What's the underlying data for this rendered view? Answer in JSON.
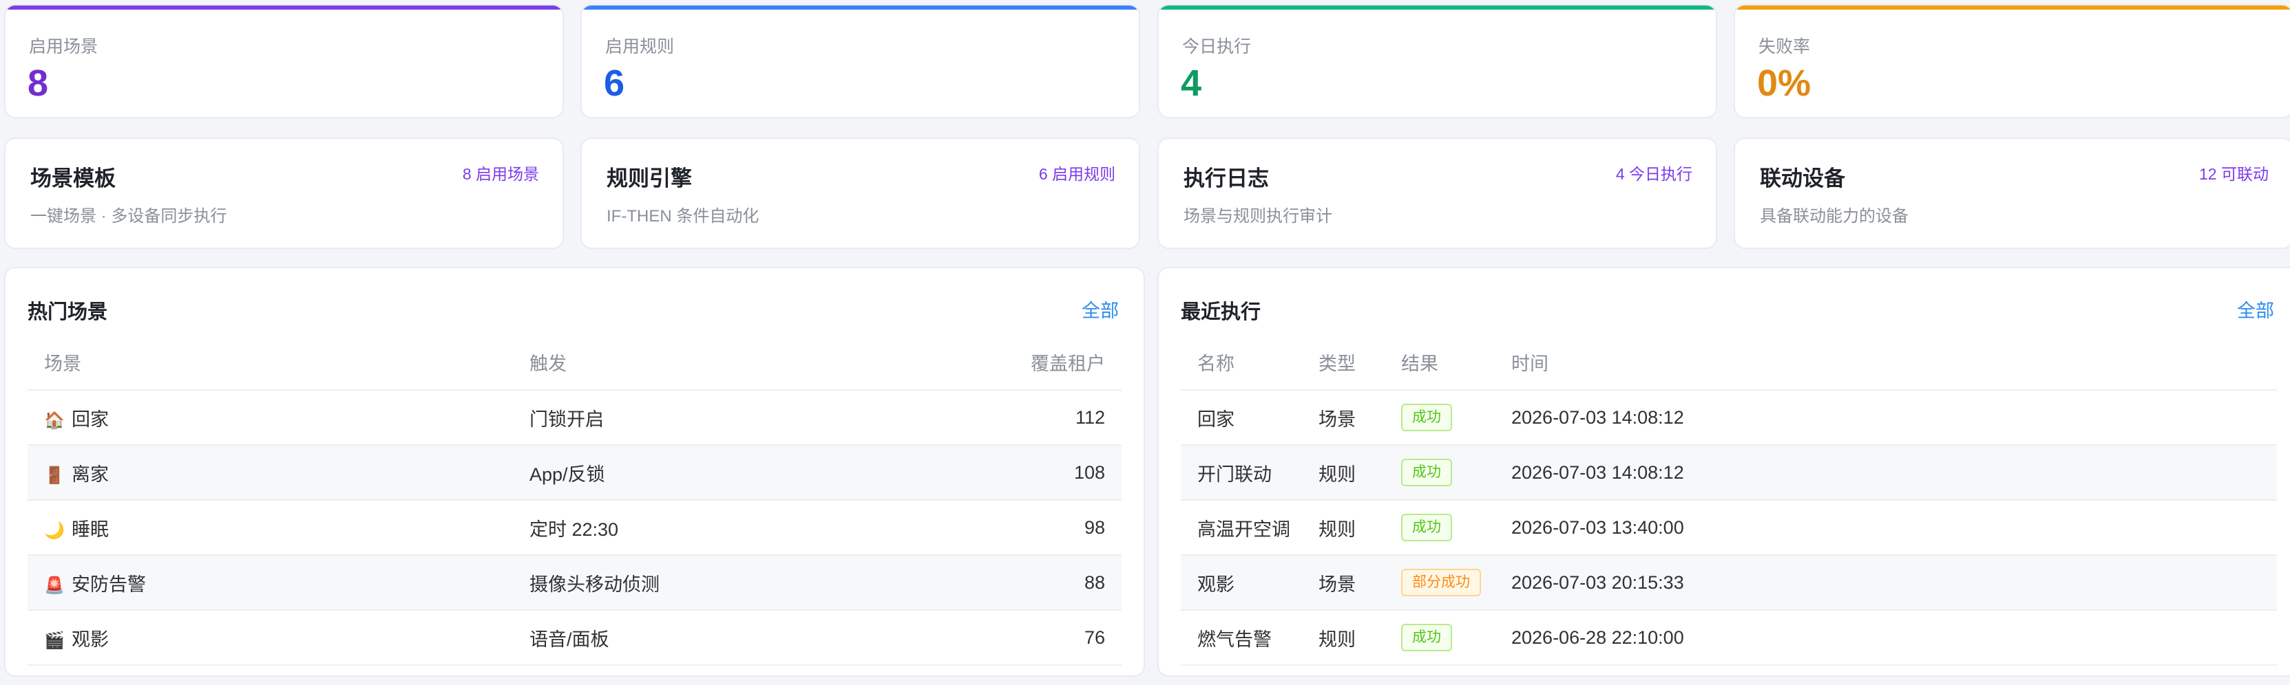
{
  "stats": [
    {
      "label": "启用场景",
      "value": "8",
      "color": "#722ed1"
    },
    {
      "label": "启用规则",
      "value": "6",
      "color": "#1d5ce6"
    },
    {
      "label": "今日执行",
      "value": "4",
      "color": "#0f9b5f"
    },
    {
      "label": "失败率",
      "value": "0%",
      "color": "#e08a12"
    }
  ],
  "stat_bar_colors": [
    "#7b3fe4",
    "#3b82f6",
    "#10b981",
    "#f59e0b"
  ],
  "modules": [
    {
      "title": "场景模板",
      "badge": "8 启用场景",
      "desc": "一键场景 · 多设备同步执行"
    },
    {
      "title": "规则引擎",
      "badge": "6 启用规则",
      "desc": "IF-THEN 条件自动化"
    },
    {
      "title": "执行日志",
      "badge": "4 今日执行",
      "desc": "场景与规则执行审计"
    },
    {
      "title": "联动设备",
      "badge": "12 可联动",
      "desc": "具备联动能力的设备"
    }
  ],
  "hot_scenes": {
    "title": "热门场景",
    "link": "全部",
    "headers": [
      "场景",
      "触发",
      "覆盖租户"
    ],
    "rows": [
      {
        "icon": "🏠",
        "icon_name": "home-icon",
        "name": "回家",
        "trigger": "门锁开启",
        "tenants": "112"
      },
      {
        "icon": "🚪",
        "icon_name": "door-icon",
        "name": "离家",
        "trigger": "App/反锁",
        "tenants": "108"
      },
      {
        "icon": "🌙",
        "icon_name": "moon-icon",
        "name": "睡眠",
        "trigger": "定时 22:30",
        "tenants": "98"
      },
      {
        "icon": "🚨",
        "icon_name": "siren-icon",
        "name": "安防告警",
        "trigger": "摄像头移动侦测",
        "tenants": "88"
      },
      {
        "icon": "🎬",
        "icon_name": "clapper-icon",
        "name": "观影",
        "trigger": "语音/面板",
        "tenants": "76"
      }
    ]
  },
  "recent_runs": {
    "title": "最近执行",
    "link": "全部",
    "headers": [
      "名称",
      "类型",
      "结果",
      "时间"
    ],
    "rows": [
      {
        "name": "回家",
        "type": "场景",
        "result": "成功",
        "status": "success",
        "time": "2026-07-03 14:08:12"
      },
      {
        "name": "开门联动",
        "type": "规则",
        "result": "成功",
        "status": "success",
        "time": "2026-07-03 14:08:12"
      },
      {
        "name": "高温开空调",
        "type": "规则",
        "result": "成功",
        "status": "success",
        "time": "2026-07-03 13:40:00"
      },
      {
        "name": "观影",
        "type": "场景",
        "result": "部分成功",
        "status": "partial",
        "time": "2026-07-03 20:15:33"
      },
      {
        "name": "燃气告警",
        "type": "规则",
        "result": "成功",
        "status": "success",
        "time": "2026-06-28 22:10:00"
      }
    ]
  }
}
